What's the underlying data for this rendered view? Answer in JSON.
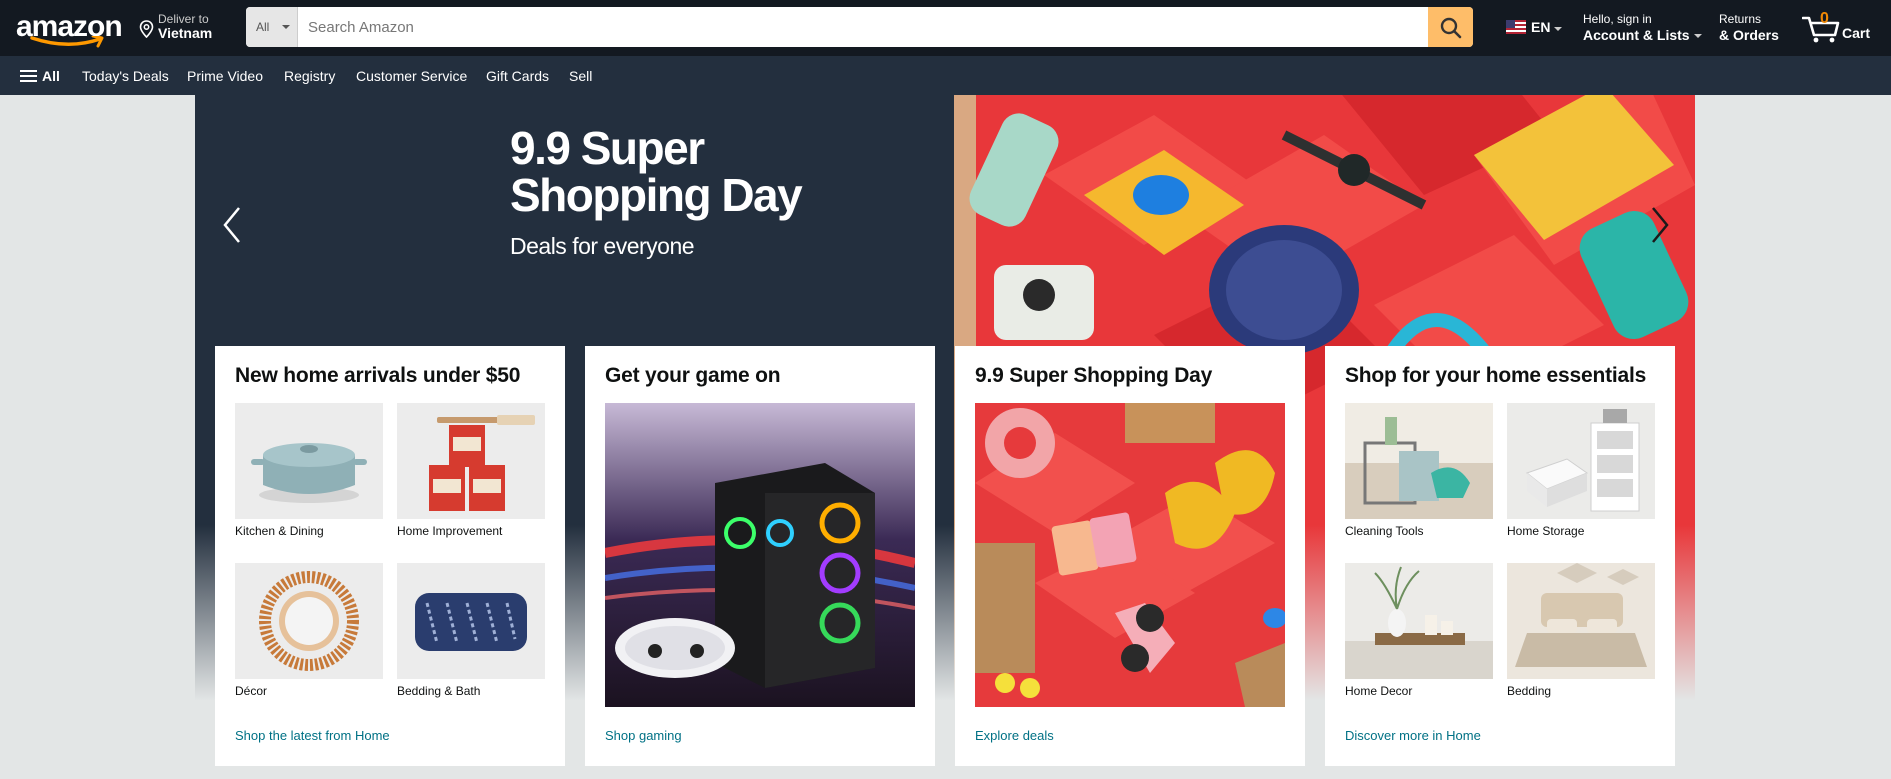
{
  "header": {
    "logo_text": "amazon",
    "deliver_line1": "Deliver to",
    "deliver_line2": "Vietnam",
    "search_category": "All",
    "search_placeholder": "Search Amazon",
    "language": "EN",
    "account_line1": "Hello, sign in",
    "account_line2": "Account & Lists",
    "returns_line1": "Returns",
    "returns_line2": "& Orders",
    "cart_count": "0",
    "cart_label": "Cart"
  },
  "subnav": {
    "all_label": "All",
    "items": [
      "Today's Deals",
      "Prime Video",
      "Registry",
      "Customer Service",
      "Gift Cards",
      "Sell"
    ]
  },
  "hero": {
    "title": "9.9 Super Shopping Day",
    "subtitle": "Deals for everyone"
  },
  "cards": [
    {
      "title": "New home arrivals under $50",
      "tiles": [
        "Kitchen & Dining",
        "Home Improvement",
        "Décor",
        "Bedding & Bath"
      ],
      "link": "Shop the latest from Home"
    },
    {
      "title": "Get your game on",
      "link": "Shop gaming"
    },
    {
      "title": "9.9 Super Shopping Day",
      "link": "Explore deals"
    },
    {
      "title": "Shop for your home essentials",
      "tiles": [
        "Cleaning Tools",
        "Home Storage",
        "Home Decor",
        "Bedding"
      ],
      "link": "Discover more in Home"
    }
  ],
  "colors": {
    "nav_dark": "#131921",
    "nav_sub": "#232f3e",
    "search_button": "#febd69",
    "cart_count": "#f08804",
    "link": "#007185",
    "hero_red": "#e8373a"
  }
}
